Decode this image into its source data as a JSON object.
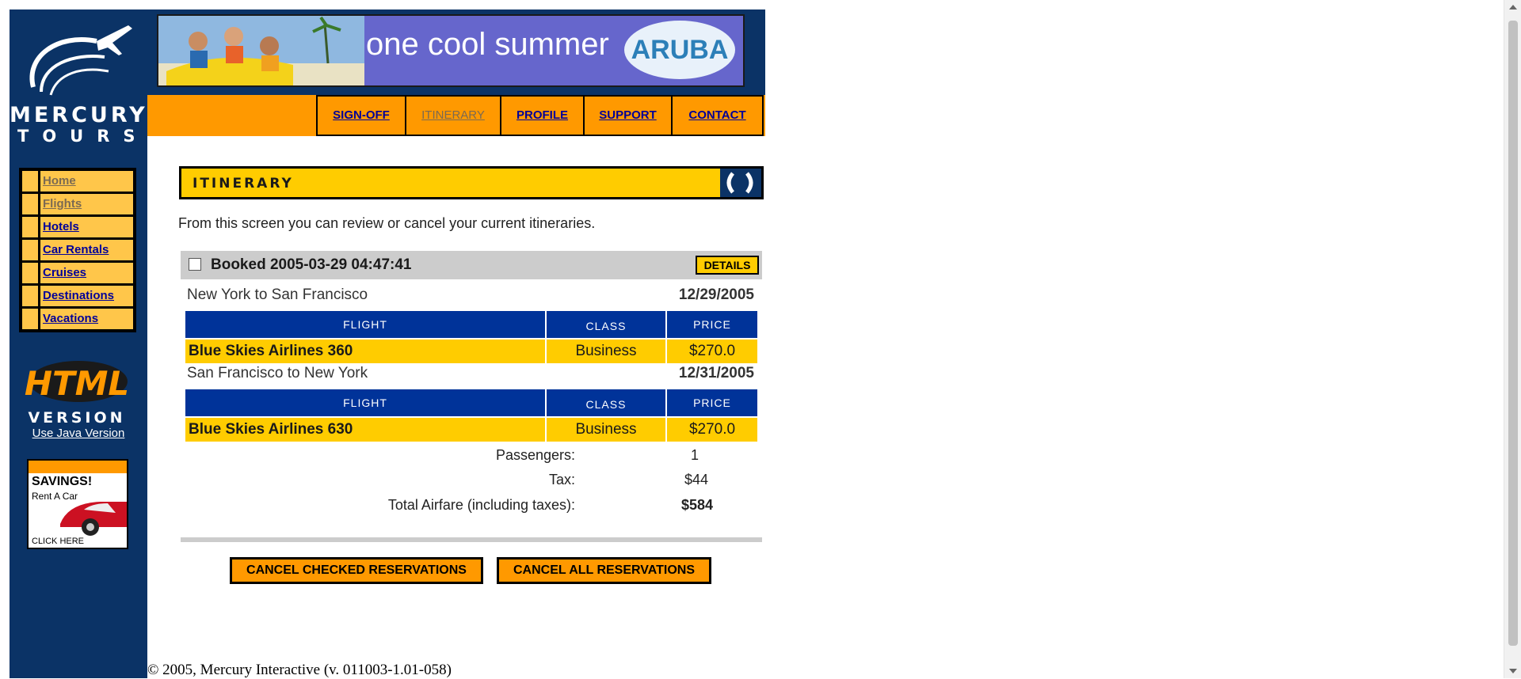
{
  "logo": {
    "word1": "MERCURY",
    "word2": "TOURS"
  },
  "banner": {
    "tagline": "one cool summer",
    "brand": "ARUBA"
  },
  "topnav": [
    {
      "label": "SIGN-OFF",
      "visited": false
    },
    {
      "label": "ITINERARY",
      "visited": true
    },
    {
      "label": "PROFILE",
      "visited": false
    },
    {
      "label": "SUPPORT",
      "visited": false
    },
    {
      "label": "CONTACT",
      "visited": false
    }
  ],
  "sidebar": {
    "items": [
      {
        "label": "Home",
        "visited": true
      },
      {
        "label": "Flights",
        "visited": true
      },
      {
        "label": "Hotels",
        "visited": false
      },
      {
        "label": "Car Rentals",
        "visited": false
      },
      {
        "label": "Cruises",
        "visited": false
      },
      {
        "label": "Destinations",
        "visited": false
      },
      {
        "label": "Vacations",
        "visited": false
      }
    ],
    "badge": {
      "line1": "HTML",
      "line2": "VERSION"
    },
    "java_link": "Use Java Version",
    "ad": {
      "title": "SAVINGS!",
      "subtitle": "Rent A Car",
      "cta": "CLICK HERE"
    }
  },
  "itinerary": {
    "title": "ITINERARY",
    "intro": "From this screen you can review or cancel your current itineraries.",
    "booking": {
      "label": "Booked 2005-03-29 04:47:41",
      "checked": false,
      "details_label": "DETAILS"
    },
    "legs": [
      {
        "route": "New York to San Francisco",
        "date": "12/29/2005",
        "headers": {
          "flight": "FLIGHT",
          "class": "CLASS",
          "price": "PRICE"
        },
        "flight": "Blue Skies Airlines 360",
        "class": "Business",
        "price": "$270.0"
      },
      {
        "route": "San Francisco to New York",
        "date": "12/31/2005",
        "headers": {
          "flight": "FLIGHT",
          "class": "CLASS",
          "price": "PRICE"
        },
        "flight": "Blue Skies Airlines 630",
        "class": "Business",
        "price": "$270.0"
      }
    ],
    "summary": {
      "passengers_label": "Passengers:",
      "passengers_value": "1",
      "tax_label": "Tax:",
      "tax_value": "$44",
      "total_label": "Total Airfare (including taxes):",
      "total_value": "$584"
    },
    "buttons": {
      "cancel_checked": "CANCEL CHECKED RESERVATIONS",
      "cancel_all": "CANCEL ALL RESERVATIONS"
    }
  },
  "footer": "© 2005, Mercury Interactive (v. 011003-1.01-058)",
  "colors": {
    "navy": "#0b3366",
    "orange": "#ff9900",
    "yellow": "#ffcc00",
    "blue_header": "#003399",
    "nav_yellow": "#ffc64a"
  }
}
